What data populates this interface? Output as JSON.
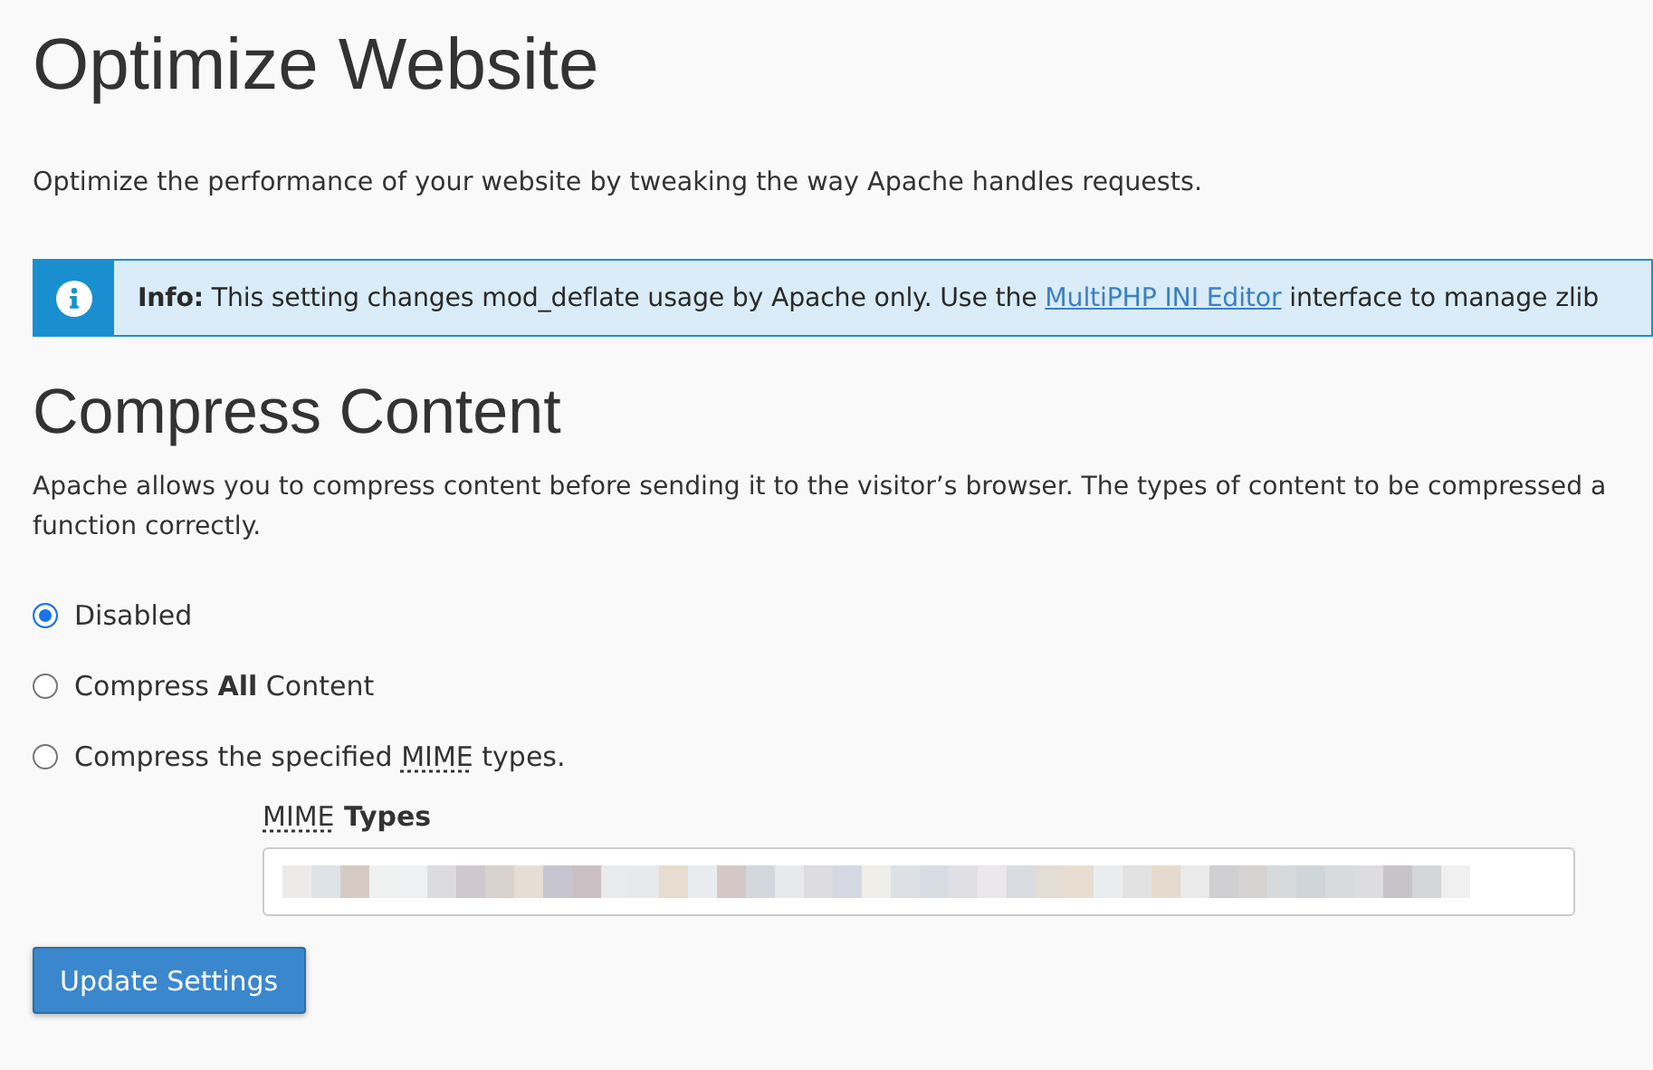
{
  "page": {
    "title": "Optimize Website",
    "description": "Optimize the performance of your website by tweaking the way Apache handles requests."
  },
  "info": {
    "label": "Info:",
    "text_before": "This setting changes mod_deflate usage by Apache only. Use the",
    "link": "MultiPHP INI Editor",
    "text_after": "interface to manage zlib"
  },
  "section": {
    "title": "Compress Content",
    "description": "Apache allows you to compress content before sending it to the visitor’s browser. The types of content to be compressed a\nfunction correctly."
  },
  "options": [
    {
      "selected": true,
      "label": [
        {
          "text": "Disabled"
        }
      ]
    },
    {
      "selected": false,
      "label": [
        {
          "text": "Compress "
        },
        {
          "text": "All",
          "kind": "bold"
        },
        {
          "text": " Content"
        }
      ]
    },
    {
      "selected": false,
      "label": [
        {
          "text": "Compress the specified "
        },
        {
          "text": "MIME",
          "kind": "abbr"
        },
        {
          "text": " types."
        }
      ]
    }
  ],
  "mime_field": {
    "label": [
      {
        "text": "MIME",
        "kind": "abbr"
      },
      {
        "text": " Types"
      }
    ]
  },
  "buttons": [
    "Update Settings"
  ]
}
